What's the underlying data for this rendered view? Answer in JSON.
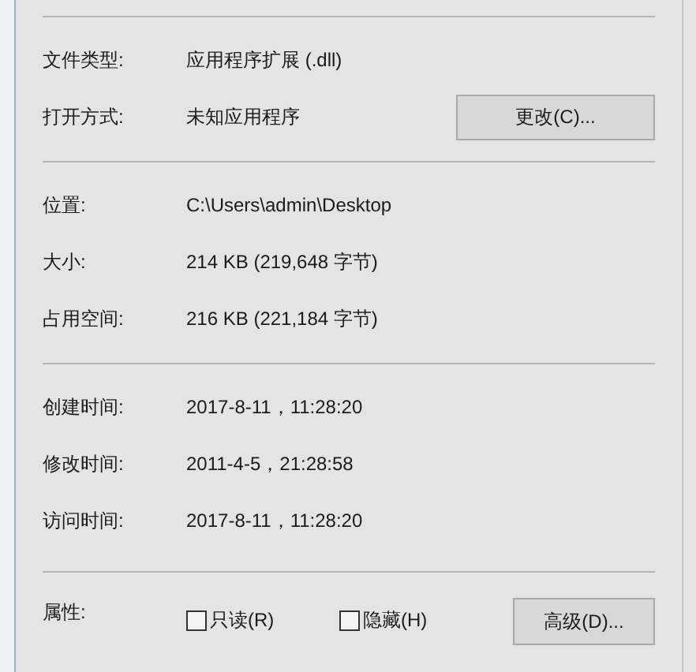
{
  "sections": [
    {
      "rows": [
        {
          "label": "文件类型:",
          "value": "应用程序扩展 (.dll)"
        },
        {
          "label": "打开方式:",
          "value": "未知应用程序",
          "button": "更改(C)..."
        }
      ]
    },
    {
      "rows": [
        {
          "label": "位置:",
          "value": "C:\\Users\\admin\\Desktop"
        },
        {
          "label": "大小:",
          "value": "214 KB (219,648 字节)"
        },
        {
          "label": "占用空间:",
          "value": "216 KB (221,184 字节)"
        }
      ]
    },
    {
      "rows": [
        {
          "label": "创建时间:",
          "value": "2017-8-11，11:28:20"
        },
        {
          "label": "修改时间:",
          "value": "2011-4-5，21:28:58"
        },
        {
          "label": "访问时间:",
          "value": "2017-8-11，11:28:20"
        }
      ]
    }
  ],
  "attributes": {
    "label": "属性:",
    "checkboxes": [
      {
        "label": "只读(R)",
        "checked": false
      },
      {
        "label": "隐藏(H)",
        "checked": false
      }
    ],
    "button": "高级(D)..."
  }
}
